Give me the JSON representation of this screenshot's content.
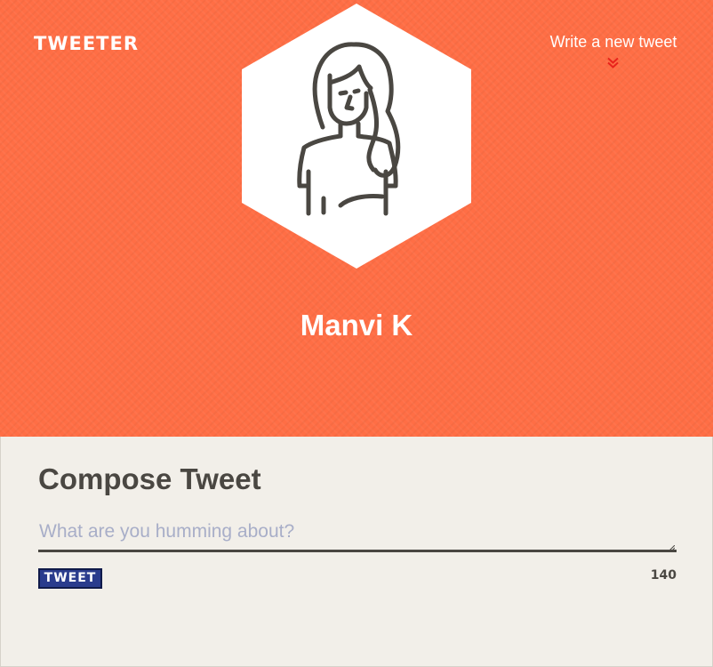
{
  "brand": {
    "logo_text": "TWEETER"
  },
  "nav": {
    "write_link": "Write a new tweet",
    "chevron_icon": "double-chevron-down-icon"
  },
  "profile": {
    "name": "Manvi K",
    "avatar_icon": "woman-avatar-icon"
  },
  "compose": {
    "title": "Compose Tweet",
    "placeholder": "What are you humming about?",
    "value": "",
    "button_label": "TWEET",
    "char_count": "140"
  },
  "colors": {
    "header_bg": "#ff6e45",
    "page_bg": "#f2efe9",
    "button_bg": "#2a3c8d",
    "text_dark": "#4a4742",
    "chevron": "#e8231c"
  }
}
